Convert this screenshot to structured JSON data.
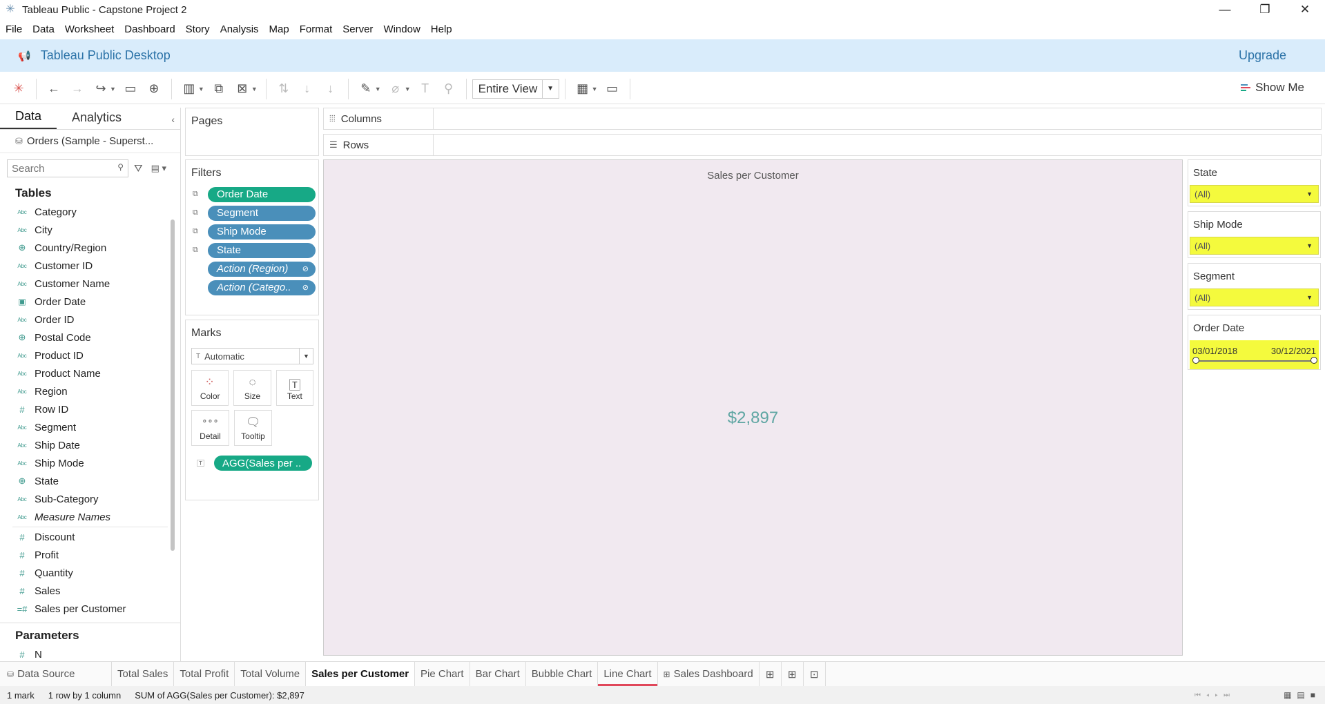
{
  "window": {
    "title": "Tableau Public - Capstone Project 2"
  },
  "menu": [
    "File",
    "Data",
    "Worksheet",
    "Dashboard",
    "Story",
    "Analysis",
    "Map",
    "Format",
    "Server",
    "Window",
    "Help"
  ],
  "banner": {
    "title": "Tableau Public Desktop",
    "upgrade": "Upgrade"
  },
  "toolbar": {
    "view_mode": "Entire View",
    "show_me": "Show Me"
  },
  "data_pane": {
    "tabs": [
      "Data",
      "Analytics"
    ],
    "datasource": "Orders (Sample - Superst...",
    "search_placeholder": "Search",
    "tables_label": "Tables",
    "dimensions": [
      {
        "type": "Abc",
        "name": "Category"
      },
      {
        "type": "Abc",
        "name": "City"
      },
      {
        "type": "geo",
        "name": "Country/Region"
      },
      {
        "type": "Abc",
        "name": "Customer ID"
      },
      {
        "type": "Abc",
        "name": "Customer Name"
      },
      {
        "type": "cal",
        "name": "Order Date"
      },
      {
        "type": "Abc",
        "name": "Order ID"
      },
      {
        "type": "geo",
        "name": "Postal Code"
      },
      {
        "type": "Abc",
        "name": "Product ID"
      },
      {
        "type": "Abc",
        "name": "Product Name"
      },
      {
        "type": "Abc",
        "name": "Region"
      },
      {
        "type": "#",
        "name": "Row ID"
      },
      {
        "type": "Abc",
        "name": "Segment"
      },
      {
        "type": "Abc",
        "name": "Ship Date"
      },
      {
        "type": "Abc",
        "name": "Ship Mode"
      },
      {
        "type": "geo",
        "name": "State"
      },
      {
        "type": "Abc",
        "name": "Sub-Category"
      },
      {
        "type": "Abc",
        "name": "Measure Names",
        "italic": true
      }
    ],
    "measures": [
      {
        "type": "#",
        "name": "Discount"
      },
      {
        "type": "#",
        "name": "Profit"
      },
      {
        "type": "#",
        "name": "Quantity"
      },
      {
        "type": "#",
        "name": "Sales"
      },
      {
        "type": "=#",
        "name": "Sales per Customer"
      }
    ],
    "parameters_label": "Parameters",
    "parameters": [
      {
        "type": "#",
        "name": "N"
      }
    ]
  },
  "pages_label": "Pages",
  "filters": {
    "label": "Filters",
    "items": [
      {
        "name": "Order Date",
        "color": "green"
      },
      {
        "name": "Segment",
        "color": "blue"
      },
      {
        "name": "Ship Mode",
        "color": "blue"
      },
      {
        "name": "State",
        "color": "blue"
      },
      {
        "name": "Action (Region)",
        "color": "blue",
        "italic": true
      },
      {
        "name": "Action (Catego..",
        "color": "blue",
        "italic": true
      }
    ]
  },
  "marks": {
    "label": "Marks",
    "type": "Automatic",
    "buttons": [
      "Color",
      "Size",
      "Text",
      "Detail",
      "Tooltip"
    ],
    "pill": "AGG(Sales per .."
  },
  "shelves": {
    "columns": "Columns",
    "rows": "Rows"
  },
  "view": {
    "title": "Sales per Customer",
    "value": "$2,897"
  },
  "quick_filters": [
    {
      "title": "State",
      "value": "(All)"
    },
    {
      "title": "Ship Mode",
      "value": "(All)"
    },
    {
      "title": "Segment",
      "value": "(All)"
    }
  ],
  "date_filter": {
    "title": "Order Date",
    "start": "03/01/2018",
    "end": "30/12/2021",
    "range_fraction": [
      0,
      1
    ]
  },
  "sheet_tabs": {
    "data_source": "Data Source",
    "sheets": [
      "Total Sales",
      "Total Profit",
      "Total Volume",
      "Sales per Customer",
      "Pie Chart",
      "Bar Chart",
      "Bubble Chart",
      "Line Chart",
      "Sales Dashboard"
    ],
    "active": "Sales per Customer"
  },
  "status": {
    "marks": "1 mark",
    "dims": "1 row by 1 column",
    "sum": "SUM of AGG(Sales per Customer): $2,897"
  },
  "colors": {
    "green_pill": "#17a986",
    "blue_pill": "#4a8fba",
    "highlight": "#f4fa3d",
    "view_bg": "#f1e9f0",
    "banner": "#d9ecfb"
  }
}
